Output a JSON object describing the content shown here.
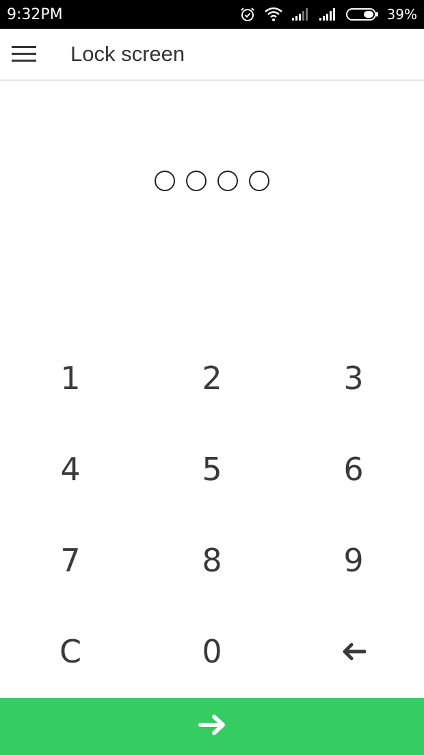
{
  "status_bar": {
    "time": "9:32PM",
    "battery_percent": "39%",
    "icons": [
      "alarm-icon",
      "wifi-icon",
      "signal-icon",
      "signal-icon",
      "battery-icon"
    ]
  },
  "app_bar": {
    "menu_icon": "hamburger-menu-icon",
    "title": "Lock screen"
  },
  "pin": {
    "length": 4,
    "entered": 0
  },
  "keypad": {
    "keys": [
      {
        "label": "1"
      },
      {
        "label": "2"
      },
      {
        "label": "3"
      },
      {
        "label": "4"
      },
      {
        "label": "5"
      },
      {
        "label": "6"
      },
      {
        "label": "7"
      },
      {
        "label": "8"
      },
      {
        "label": "9"
      },
      {
        "label": "C"
      },
      {
        "label": "0"
      },
      {
        "label": "",
        "icon": "backspace-arrow-icon"
      }
    ]
  },
  "submit": {
    "icon": "arrow-right-icon",
    "color": "#35cc62"
  },
  "colors": {
    "status_bar_bg": "#000000",
    "accent": "#35cc62",
    "text": "#333333"
  }
}
